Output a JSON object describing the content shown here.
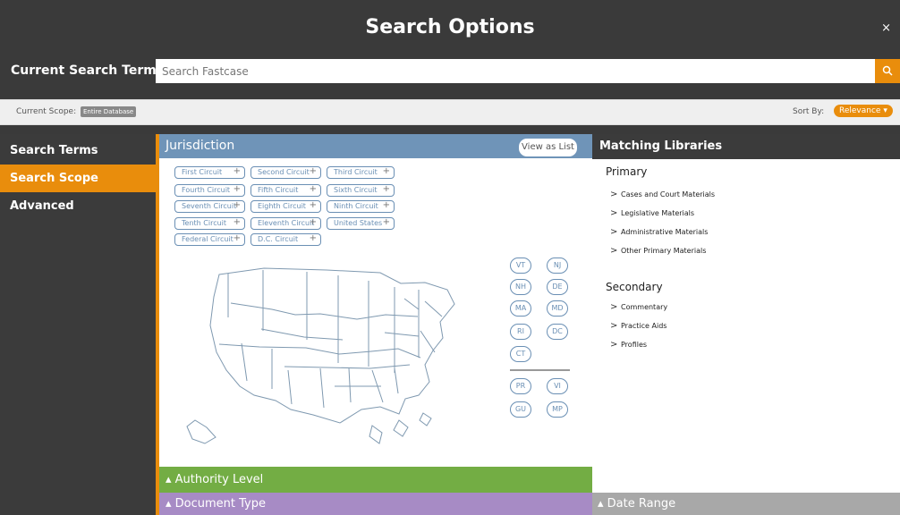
{
  "title": "Search Options",
  "close": "×",
  "search_terms_label": "Current Search Terms:",
  "search_placeholder": "Search Fastcase",
  "search_icon": "search-icon",
  "scope_label": "Current Scope:",
  "scope_value": "Entire Database",
  "sort_label": "Sort By:",
  "sort_value": "Relevance ▾",
  "nav": [
    "Search Terms",
    "Search Scope",
    "Advanced"
  ],
  "jurisdiction": {
    "title": "Jurisdiction",
    "view_as_list": "View as List"
  },
  "circuits": [
    "First Circuit",
    "Second Circuit",
    "Third Circuit",
    "Fourth Circuit",
    "Fifth Circuit",
    "Sixth Circuit",
    "Seventh Circuit",
    "Eighth Circuit",
    "Ninth Circuit",
    "Tenth Circuit",
    "Eleventh Circuit",
    "United States",
    "Federal Circuit",
    "D.C. Circuit"
  ],
  "states": [
    "VT",
    "NJ",
    "NH",
    "DE",
    "MA",
    "MD",
    "RI",
    "DC",
    "CT",
    "PR",
    "VI",
    "GU",
    "MP"
  ],
  "authority_level": "▴ Authority Level",
  "document_type": "▴ Document Type",
  "matching_libraries": "Matching Libraries",
  "primary": "Primary",
  "primary_items": [
    "Cases and Court Materials",
    "Legislative Materials",
    "Administrative Materials",
    "Other Primary Materials"
  ],
  "secondary": "Secondary",
  "secondary_items": [
    "Commentary",
    "Practice Aids",
    "Profiles"
  ],
  "date_range": "▴ Date Range",
  "colors": {
    "accent": "#e98d0c",
    "jurisdiction": "#6f94b8",
    "authority": "#73ad44",
    "document": "#a78bc5",
    "dark": "#3a3a3a"
  }
}
